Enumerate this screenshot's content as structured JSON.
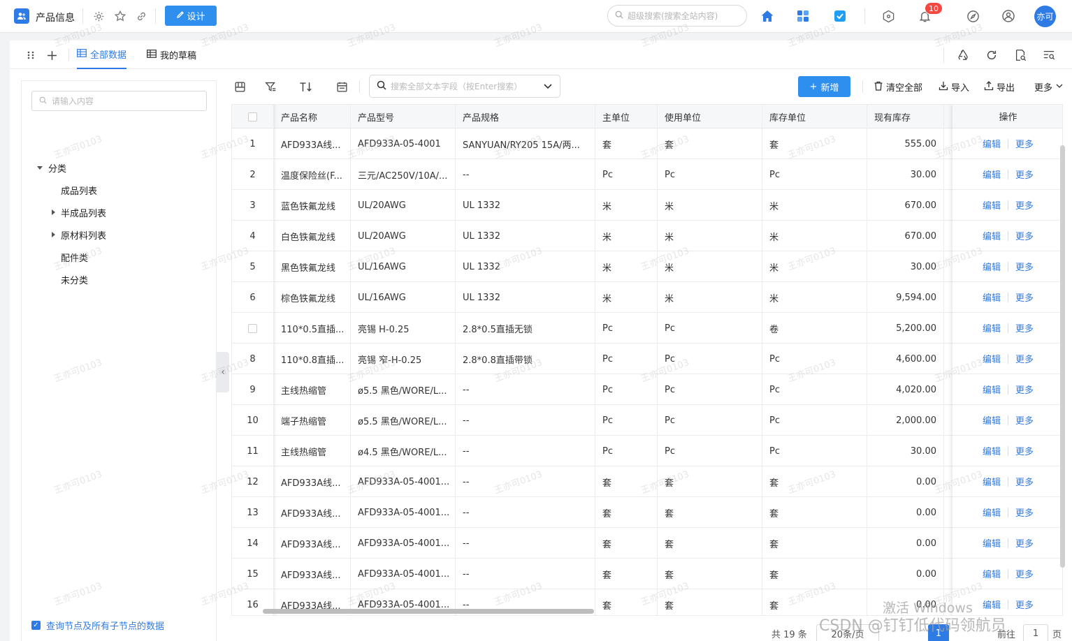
{
  "app": {
    "title": "产品信息",
    "design_label": "设计",
    "global_search_placeholder": "超级搜索(搜索全站内容)",
    "notification_count": "10",
    "avatar_label": "亦可"
  },
  "views": {
    "tabs": [
      {
        "label": "全部数据",
        "active": true
      },
      {
        "label": "我的草稿",
        "active": false
      }
    ]
  },
  "sidebar": {
    "search_placeholder": "请输入内容",
    "root_label": "分类",
    "items": [
      {
        "label": "成品列表",
        "expandable": false
      },
      {
        "label": "半成品列表",
        "expandable": true
      },
      {
        "label": "原材料列表",
        "expandable": true
      },
      {
        "label": "配件类",
        "expandable": false
      },
      {
        "label": "未分类",
        "expandable": false
      }
    ],
    "include_children_label": "查询节点及所有子节点的数据"
  },
  "toolbar": {
    "field_search_placeholder": "搜索全部文本字段（按Enter搜索）",
    "add_label": "新增",
    "clear_label": "清空全部",
    "import_label": "导入",
    "export_label": "导出",
    "more_label": "更多"
  },
  "table": {
    "columns": [
      "产品名称",
      "产品型号",
      "产品规格",
      "主单位",
      "使用单位",
      "库存单位",
      "现有库存"
    ],
    "op_header": "操作",
    "edit_label": "编辑",
    "more_label": "更多",
    "rows": [
      {
        "no": "1",
        "name": "AFD933A线...",
        "model": "AFD933A-05-4001",
        "spec": "SANYUAN/RY205 15A/两...",
        "main_unit": "套",
        "use_unit": "套",
        "stock_unit": "套",
        "stock": "555.00"
      },
      {
        "no": "2",
        "name": "温度保险丝(F...",
        "model": "三元/AC250V/10A/...",
        "spec": "--",
        "main_unit": "Pc",
        "use_unit": "Pc",
        "stock_unit": "Pc",
        "stock": "30.00"
      },
      {
        "no": "3",
        "name": "蓝色铁氟龙线",
        "model": "UL/20AWG",
        "spec": "UL 1332",
        "main_unit": "米",
        "use_unit": "米",
        "stock_unit": "米",
        "stock": "670.00"
      },
      {
        "no": "4",
        "name": "白色铁氟龙线",
        "model": "UL/20AWG",
        "spec": "UL 1332",
        "main_unit": "米",
        "use_unit": "米",
        "stock_unit": "米",
        "stock": "670.00"
      },
      {
        "no": "5",
        "name": "黑色铁氟龙线",
        "model": "UL/16AWG",
        "spec": "UL 1332",
        "main_unit": "米",
        "use_unit": "米",
        "stock_unit": "米",
        "stock": "30.00"
      },
      {
        "no": "6",
        "name": "棕色铁氟龙线",
        "model": "UL/16AWG",
        "spec": "UL 1332",
        "main_unit": "米",
        "use_unit": "米",
        "stock_unit": "米",
        "stock": "9,594.00"
      },
      {
        "no": "",
        "name": "110*0.5直插...",
        "model": "亮锡 H-0.25",
        "spec": "2.8*0.5直插无锁",
        "main_unit": "Pc",
        "use_unit": "Pc",
        "stock_unit": "卷",
        "stock": "5,200.00"
      },
      {
        "no": "8",
        "name": "110*0.8直插...",
        "model": "亮锡 窄-H-0.25",
        "spec": "2.8*0.8直插带锁",
        "main_unit": "Pc",
        "use_unit": "Pc",
        "stock_unit": "Pc",
        "stock": "4,600.00"
      },
      {
        "no": "9",
        "name": "主线热缩管",
        "model": "ø5.5 黑色/WORE/L...",
        "spec": "--",
        "main_unit": "Pc",
        "use_unit": "Pc",
        "stock_unit": "Pc",
        "stock": "4,020.00"
      },
      {
        "no": "10",
        "name": "端子热缩管",
        "model": "ø5.5 黑色/WORE/L...",
        "spec": "--",
        "main_unit": "Pc",
        "use_unit": "Pc",
        "stock_unit": "Pc",
        "stock": "2,000.00"
      },
      {
        "no": "11",
        "name": "主线热缩管",
        "model": "ø4.5 黑色/WORE/L...",
        "spec": "--",
        "main_unit": "Pc",
        "use_unit": "Pc",
        "stock_unit": "Pc",
        "stock": "30.00"
      },
      {
        "no": "12",
        "name": "AFD933A线...",
        "model": "AFD933A-05-4001...",
        "spec": "--",
        "main_unit": "套",
        "use_unit": "套",
        "stock_unit": "套",
        "stock": "0.00"
      },
      {
        "no": "13",
        "name": "AFD933A线...",
        "model": "AFD933A-05-4001...",
        "spec": "--",
        "main_unit": "套",
        "use_unit": "套",
        "stock_unit": "套",
        "stock": "0.00"
      },
      {
        "no": "14",
        "name": "AFD933A线...",
        "model": "AFD933A-05-4001...",
        "spec": "--",
        "main_unit": "套",
        "use_unit": "套",
        "stock_unit": "套",
        "stock": "0.00"
      },
      {
        "no": "15",
        "name": "AFD933A线...",
        "model": "AFD933A-05-4001...",
        "spec": "--",
        "main_unit": "套",
        "use_unit": "套",
        "stock_unit": "套",
        "stock": "0.00"
      },
      {
        "no": "16",
        "name": "AFD933A线...",
        "model": "AFD933A-05-4001...",
        "spec": "--",
        "main_unit": "套",
        "use_unit": "套",
        "stock_unit": "套",
        "stock": "0.00"
      }
    ]
  },
  "pagination": {
    "total_label": "共 19 条",
    "page_size": "20条/页",
    "current_page": "1",
    "goto_label": "前往",
    "goto_value": "1",
    "page_suffix": "页"
  },
  "overlays": {
    "watermark": "王亦可0103",
    "activate_windows": "激活 Windows",
    "csdn": "CSDN @钉钉低代码领航员"
  },
  "colors": {
    "accent": "#2f7be6",
    "button": "#2f8fef",
    "badge": "#f5463f"
  }
}
